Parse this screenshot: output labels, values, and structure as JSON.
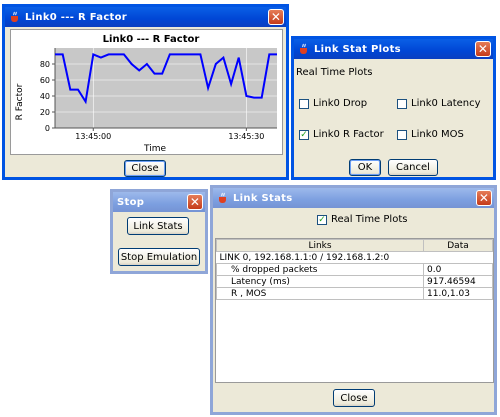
{
  "rfactor_window": {
    "title": "Link0 --- R Factor",
    "close_label": "Close",
    "chart_data": {
      "type": "line",
      "title": "Link0 --- R Factor",
      "xlabel": "Time",
      "ylabel": "R Factor",
      "ylim": [
        0,
        100
      ],
      "yticks": [
        "0",
        "20",
        "40",
        "60",
        "80"
      ],
      "xticks": [
        "13:45:00",
        "13:45:30"
      ],
      "series": [
        {
          "values": [
            92,
            92,
            48,
            48,
            33,
            92,
            88,
            92,
            92,
            92,
            80,
            72,
            80,
            68,
            68,
            92,
            92,
            92,
            92,
            92,
            50,
            80,
            88,
            55,
            88,
            40,
            38,
            38,
            92,
            92
          ],
          "color": "#0000ff"
        }
      ]
    }
  },
  "linkstat_window": {
    "title": "Link Stat Plots",
    "section_label": "Real Time Plots",
    "options": [
      {
        "label": "Link0 Drop",
        "checked": false
      },
      {
        "label": "Link0 Latency",
        "checked": false
      },
      {
        "label": "Link0 R Factor",
        "checked": true
      },
      {
        "label": "Link0 MOS",
        "checked": false
      }
    ],
    "ok_label": "OK",
    "cancel_label": "Cancel"
  },
  "stop_window": {
    "title": "Stop",
    "link_stats_label": "Link Stats",
    "stop_emulation_label": "Stop Emulation"
  },
  "linkstats_window": {
    "title": "Link Stats",
    "realtime_label": "Real Time Plots",
    "realtime_checked": true,
    "columns": [
      "Links",
      "Data"
    ],
    "rows": [
      {
        "link": "LINK 0, 192.168.1.1:0 / 192.168.1.2:0",
        "data": ""
      },
      {
        "link": "% dropped packets",
        "data": "0.0"
      },
      {
        "link": "Latency (ms)",
        "data": "917.46594"
      },
      {
        "link": "R , MOS",
        "data": "11.0,1.03"
      }
    ],
    "close_label": "Close"
  },
  "colors": {
    "active_title": "#0054e3",
    "inactive_title": "#7c9fe0",
    "plot_background": "#c8c8c8",
    "series_line": "#0000ff"
  }
}
